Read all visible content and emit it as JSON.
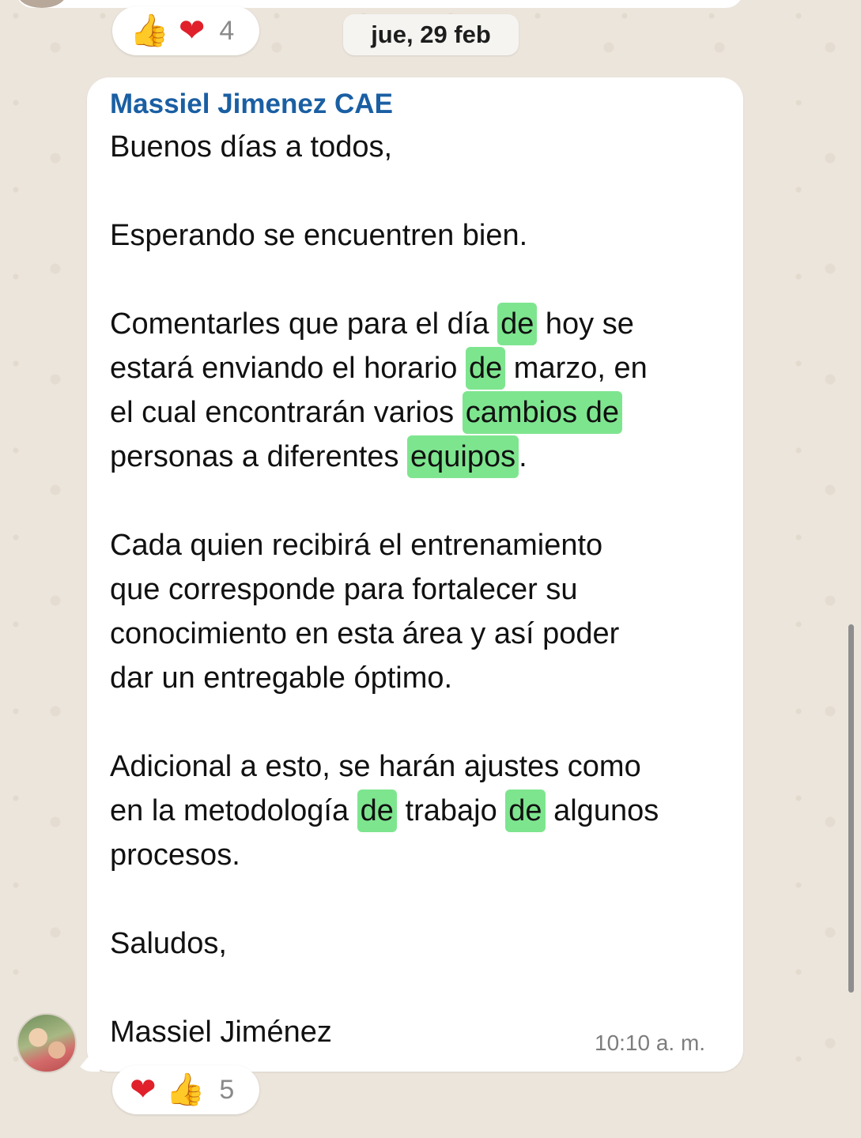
{
  "date_chip": "jue, 29 feb",
  "reactions_top": {
    "emoji_1": "👍",
    "emoji_2": "❤",
    "count": "4"
  },
  "message": {
    "sender": "Massiel Jimenez CAE",
    "time": "10:10 a. m.",
    "lines": [
      {
        "text": "Buenos días a todos,"
      },
      {
        "text": "Esperando se encuentren bien."
      },
      {
        "before": "Comentarles que para el día ",
        "hl": "de",
        "after": " hoy se"
      },
      {
        "before": "estará enviando el horario ",
        "hl": "de",
        "after": " marzo, en"
      },
      {
        "before": "el cual encontrarán varios ",
        "hl": "cambios de",
        "after": ""
      },
      {
        "before": "personas a diferentes ",
        "hl": "equipos",
        "after": "."
      },
      {
        "text": "Cada quien recibirá el entrenamiento"
      },
      {
        "text": "que corresponde para fortalecer su"
      },
      {
        "text": "conocimiento en esta área y así poder"
      },
      {
        "text": "dar un entregable óptimo."
      },
      {
        "text": "Adicional a esto, se harán ajustes como"
      },
      {
        "before": "en la metodología ",
        "hl": "de",
        "mid": " trabajo ",
        "hl2": "de",
        "after": " algunos"
      },
      {
        "text": "procesos."
      },
      {
        "text": "Saludos,"
      },
      {
        "text": "Massiel Jiménez"
      }
    ]
  },
  "reactions_bottom": {
    "emoji_1": "❤",
    "emoji_2": "👍",
    "count": "5"
  },
  "colors": {
    "highlight": "#7ee58f",
    "sender": "#1a5fa3",
    "background": "#ece5dc"
  }
}
